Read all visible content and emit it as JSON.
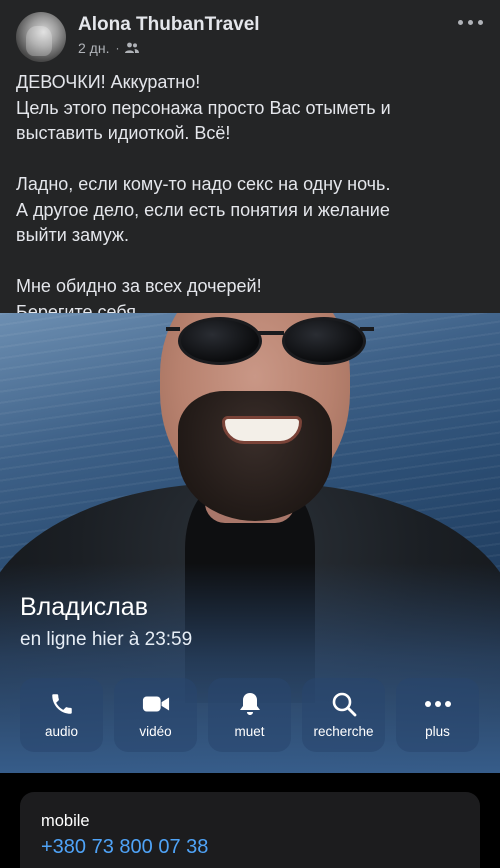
{
  "post": {
    "author": "Alona ThubanTravel",
    "time": "2 дн.",
    "separator": "·",
    "privacy_icon": "friends-icon",
    "more_icon": "more-dots-icon",
    "paragraphs": [
      {
        "lines": [
          "ДЕВОЧКИ! Аккуратно!",
          "Цель этого персонажа просто Вас отыметь и",
          "выставить идиоткой. Всё!"
        ]
      },
      {
        "lines": [
          "Ладно, если кому-то надо секс на одну ночь.",
          "А другое дело, если есть понятия и желание",
          "выйти замуж."
        ]
      },
      {
        "lines": [
          "Мне обидно за всех дочерей!",
          "Берегите себя."
        ]
      }
    ]
  },
  "contact": {
    "name": "Владислав",
    "status": "en ligne hier à 23:59",
    "actions": [
      {
        "label": "audio",
        "icon": "phone-icon"
      },
      {
        "label": "vidéo",
        "icon": "video-camera-icon"
      },
      {
        "label": "muet",
        "icon": "bell-icon"
      },
      {
        "label": "recherche",
        "icon": "search-icon"
      },
      {
        "label": "plus",
        "icon": "ellipsis-icon"
      }
    ],
    "phone_label": "mobile",
    "phone_value": "+380 73 800 07 38"
  },
  "colors": {
    "background": "#242526",
    "link_blue": "#4fa3f7",
    "text": "#e4e6eb",
    "muted": "#b0b3b8"
  }
}
